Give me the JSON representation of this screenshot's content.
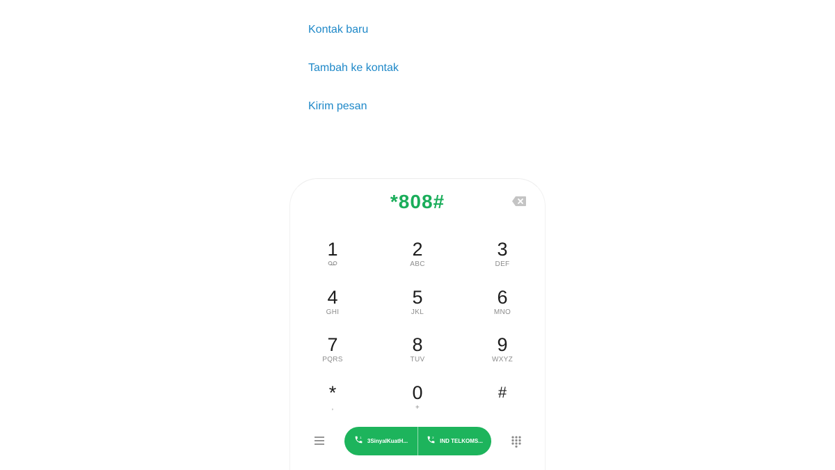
{
  "actions": {
    "new_contact": "Kontak baru",
    "add_to_contact": "Tambah ke kontak",
    "send_message": "Kirim pesan"
  },
  "dialer": {
    "number": "*808#",
    "backspace_icon": "backspace-icon"
  },
  "keypad": {
    "keys": [
      {
        "digit": "1",
        "letters": "voicemail-icon"
      },
      {
        "digit": "2",
        "letters": "ABC"
      },
      {
        "digit": "3",
        "letters": "DEF"
      },
      {
        "digit": "4",
        "letters": "GHI"
      },
      {
        "digit": "5",
        "letters": "JKL"
      },
      {
        "digit": "6",
        "letters": "MNO"
      },
      {
        "digit": "7",
        "letters": "PQRS"
      },
      {
        "digit": "8",
        "letters": "TUV"
      },
      {
        "digit": "9",
        "letters": "WXYZ"
      },
      {
        "digit": "*",
        "letters": ","
      },
      {
        "digit": "0",
        "letters": "+"
      },
      {
        "digit": "#",
        "letters": ""
      }
    ]
  },
  "bottom_bar": {
    "menu_icon": "menu-icon",
    "sim1_label": "3SinyalKuatH...",
    "sim2_label": "IND TELKOMS...",
    "keypad_icon": "dialpad-icon"
  },
  "colors": {
    "accent_link": "#1e88c8",
    "number_green": "#1aad5a",
    "call_green": "#1db45c"
  }
}
